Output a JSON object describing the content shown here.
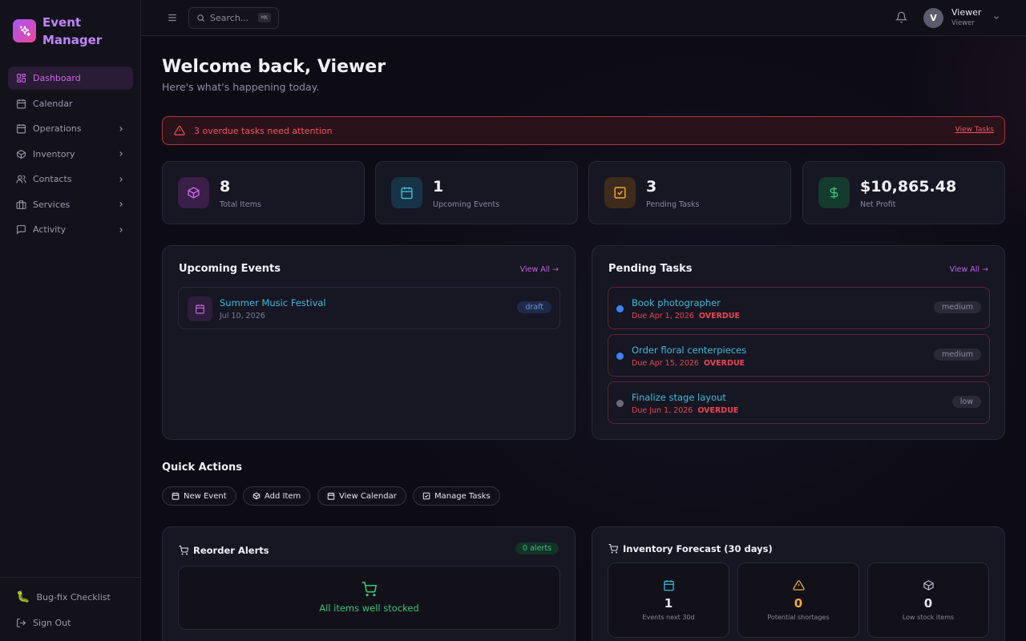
{
  "brand": {
    "line1": "Event",
    "line2": "Manager"
  },
  "sidebar": {
    "items": [
      {
        "label": "Dashboard"
      },
      {
        "label": "Calendar"
      },
      {
        "label": "Operations"
      },
      {
        "label": "Inventory"
      },
      {
        "label": "Contacts"
      },
      {
        "label": "Services"
      },
      {
        "label": "Activity"
      }
    ],
    "footer": {
      "checklist": "Bug-fix Checklist",
      "signout": "Sign Out"
    }
  },
  "topbar": {
    "search_placeholder": "Search...",
    "search_shortcut": "⌘K",
    "avatar_initial": "V",
    "user_name": "Viewer",
    "user_role": "Viewer"
  },
  "header": {
    "welcome": "Welcome back, Viewer",
    "subtitle": "Here's what's happening today."
  },
  "alert": {
    "message": "3 overdue tasks need attention",
    "link": "View Tasks"
  },
  "stats": [
    {
      "value": "8",
      "label": "Total Items",
      "color": "#d167e8"
    },
    {
      "value": "1",
      "label": "Upcoming Events",
      "color": "#3fbcd9"
    },
    {
      "value": "3",
      "label": "Pending Tasks",
      "color": "#f2a93b"
    },
    {
      "value": "$10,865.48",
      "label": "Net Profit",
      "color": "#3cc37a"
    }
  ],
  "upcoming_events": {
    "title": "Upcoming Events",
    "view_all": "View All →",
    "events": [
      {
        "name": "Summer Music Festival",
        "date": "Jul 10, 2026",
        "status": "draft"
      }
    ]
  },
  "pending_tasks": {
    "title": "Pending Tasks",
    "view_all": "View All →",
    "tasks": [
      {
        "name": "Book photographer",
        "due": "Due Apr 1, 2026",
        "flag": "OVERDUE",
        "priority": "medium",
        "dot_color": "#3b82f6"
      },
      {
        "name": "Order floral centerpieces",
        "due": "Due Apr 15, 2026",
        "flag": "OVERDUE",
        "priority": "medium",
        "dot_color": "#3b82f6"
      },
      {
        "name": "Finalize stage layout",
        "due": "Due Jun 1, 2026",
        "flag": "OVERDUE",
        "priority": "low",
        "dot_color": "#6b6b78"
      }
    ]
  },
  "quick_actions": {
    "title": "Quick Actions",
    "buttons": [
      {
        "label": "New Event"
      },
      {
        "label": "Add Item"
      },
      {
        "label": "View Calendar"
      },
      {
        "label": "Manage Tasks"
      }
    ]
  },
  "reorder_alerts": {
    "title": "Reorder Alerts",
    "badge": "0 alerts",
    "empty_text": "All items well stocked"
  },
  "forecast": {
    "title": "Inventory Forecast (30 days)",
    "cards": [
      {
        "value": "1",
        "label": "Events next 30d",
        "color": "#3fbcd9"
      },
      {
        "value": "0",
        "label": "Potential shortages",
        "color": "#f2a93b"
      },
      {
        "value": "0",
        "label": "Low stock items",
        "color": "#b8b6c6"
      }
    ]
  }
}
